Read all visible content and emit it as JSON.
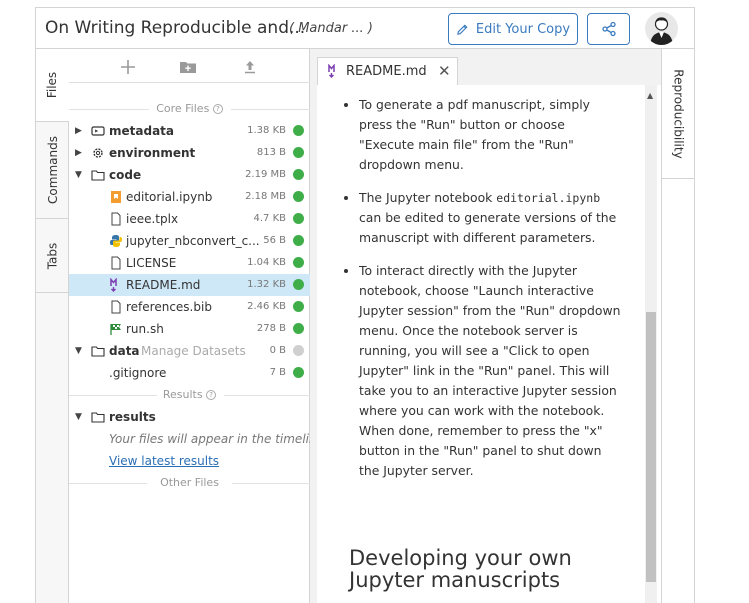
{
  "header": {
    "title": "On Writing Reproducible and...",
    "subtitle": "( Mandar ...     )",
    "edit_button": "Edit Your Copy",
    "share_icon": "share-icon",
    "avatar_icon": "user-avatar"
  },
  "left_tabs": [
    "Files",
    "Commands",
    "Tabs"
  ],
  "right_tabs": [
    "Reproducibility"
  ],
  "file_toolbar": {
    "icons": [
      "add-icon",
      "new-folder-icon",
      "upload-icon"
    ]
  },
  "sections": {
    "core_files": "Core Files",
    "results": "Results",
    "other_files": "Other Files"
  },
  "core_files": [
    {
      "name": "metadata",
      "size": "1.38 KB",
      "type": "folder-closed",
      "icon": "metadata-icon",
      "status": "ok"
    },
    {
      "name": "environment",
      "size": "813 B",
      "type": "folder-closed",
      "icon": "gear-icon",
      "status": "ok"
    },
    {
      "name": "code",
      "size": "2.19 MB",
      "type": "folder-open",
      "icon": "folder-icon",
      "status": "ok"
    },
    {
      "name": "editorial.ipynb",
      "size": "2.18 MB",
      "type": "file",
      "icon": "notebook-icon",
      "status": "ok"
    },
    {
      "name": "ieee.tplx",
      "size": "4.7 KB",
      "type": "file",
      "icon": "file-icon",
      "status": "ok"
    },
    {
      "name": "jupyter_nbconvert_c...",
      "size": "56 B",
      "type": "file",
      "icon": "python-icon",
      "status": "ok"
    },
    {
      "name": "LICENSE",
      "size": "1.04 KB",
      "type": "file",
      "icon": "file-icon",
      "status": "ok"
    },
    {
      "name": "README.md",
      "size": "1.32 KB",
      "type": "file",
      "icon": "markdown-icon",
      "status": "ok",
      "selected": true
    },
    {
      "name": "references.bib",
      "size": "2.46 KB",
      "type": "file",
      "icon": "file-icon",
      "status": "ok"
    },
    {
      "name": "run.sh",
      "size": "278 B",
      "type": "file",
      "icon": "run-script-icon",
      "status": "ok"
    },
    {
      "name": "data",
      "extra": "Manage Datasets",
      "size": "0 B",
      "type": "folder-open",
      "icon": "folder-icon",
      "status": "none"
    },
    {
      "name": ".gitignore",
      "size": "7 B",
      "type": "file",
      "icon": "none",
      "status": "ok"
    }
  ],
  "results": {
    "folder": "results",
    "hint": "Your files will appear in the timeline",
    "link": "View latest results"
  },
  "editor": {
    "tab_label": "README.md",
    "bullets": [
      {
        "text": "To generate a pdf manuscript, simply press the \"Run\" button or choose \"Execute main file\" from the \"Run\" dropdown menu."
      },
      {
        "pre": "The Jupyter notebook ",
        "code": "editorial.ipynb",
        "post": " can be edited to generate versions of the manuscript with different parameters."
      },
      {
        "text": "To interact directly with the Jupyter notebook, choose \"Launch interactive Jupyter session\" from the \"Run\" dropdown menu. Once the notebook server is running, you will see a \"Click to open Jupyter\" link in the \"Run\" panel. This will take you to an interactive Jupyter session where you can work with the notebook. When done, remember to press the \"x\" button in the \"Run\" panel to shut down the Jupyter server."
      }
    ],
    "heading": "Developing your own Jupyter manuscripts"
  },
  "colors": {
    "accent": "#3a7bbf",
    "status_ok": "#3fae49",
    "selection": "#cfe8f7"
  }
}
